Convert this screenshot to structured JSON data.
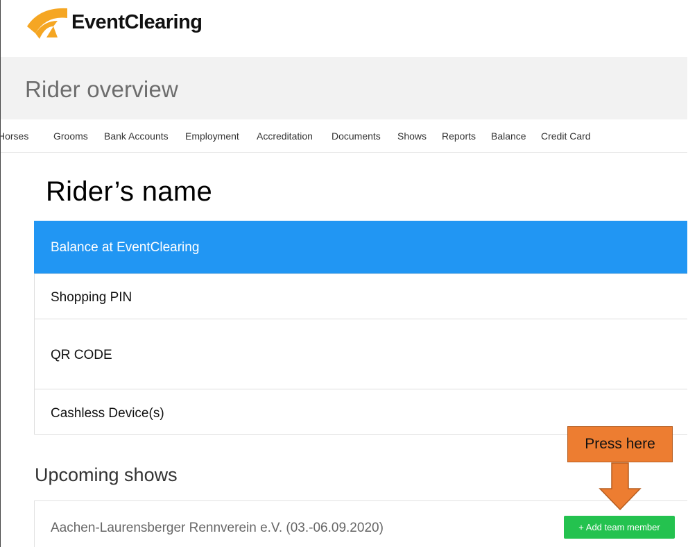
{
  "brand": {
    "name": "EventClearing",
    "logo_color": "#f5a623"
  },
  "page": {
    "title": "Rider overview"
  },
  "nav": {
    "items": [
      "Horses",
      "Grooms",
      "Bank Accounts",
      "Employment",
      "Accreditation",
      "Documents",
      "Shows",
      "Reports",
      "Balance",
      "Credit Card"
    ]
  },
  "rider": {
    "name": "Rider’s name"
  },
  "panels": [
    {
      "label": "Balance at EventClearing",
      "active": true
    },
    {
      "label": "Shopping PIN",
      "active": false
    },
    {
      "label": "QR CODE",
      "active": false
    },
    {
      "label": "Cashless Device(s)",
      "active": false
    }
  ],
  "upcoming": {
    "title": "Upcoming shows",
    "shows": [
      {
        "name": "Aachen-Laurensberger Rennverein e.V. (03.-06.09.2020)",
        "action_label": "+ Add team member"
      }
    ]
  },
  "annotation": {
    "text": "Press here",
    "color": "#ed7d31"
  },
  "colors": {
    "active_panel": "#2196f3",
    "add_button": "#24c24f"
  }
}
